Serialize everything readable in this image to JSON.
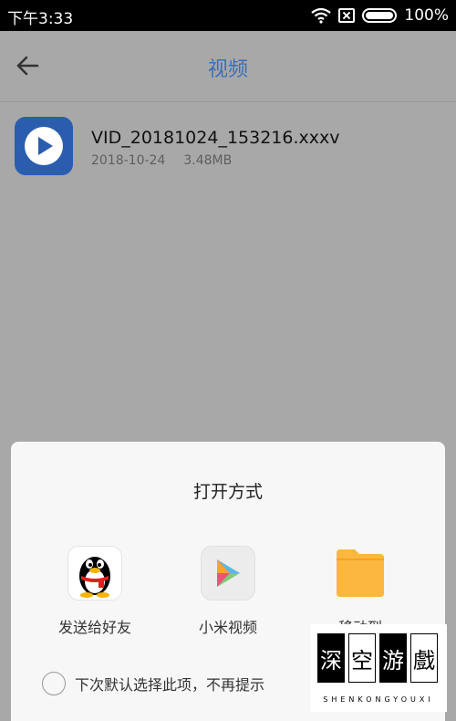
{
  "status_bar": {
    "time": "下午3:33",
    "battery": "100%"
  },
  "header": {
    "title": "视频"
  },
  "file": {
    "name": "VID_20181024_153216.xxxv",
    "date": "2018-10-24",
    "size": "3.48MB"
  },
  "dialog": {
    "title": "打开方式",
    "apps": [
      {
        "label": "发送给好友",
        "icon": "qq-penguin-icon"
      },
      {
        "label": "小米视频",
        "icon": "mi-video-icon"
      },
      {
        "label": "移动到",
        "icon": "folder-icon"
      }
    ],
    "remember_label": "下次默认选择此项，不再提示"
  },
  "watermark": {
    "chars": [
      "深",
      "空",
      "游",
      "戲"
    ],
    "subtitle": "SHENKONGYOUXI"
  },
  "colors": {
    "title_blue": "#3a6fb8",
    "thumb_blue": "#2a5dad",
    "folder_orange": "#fbb73f"
  }
}
